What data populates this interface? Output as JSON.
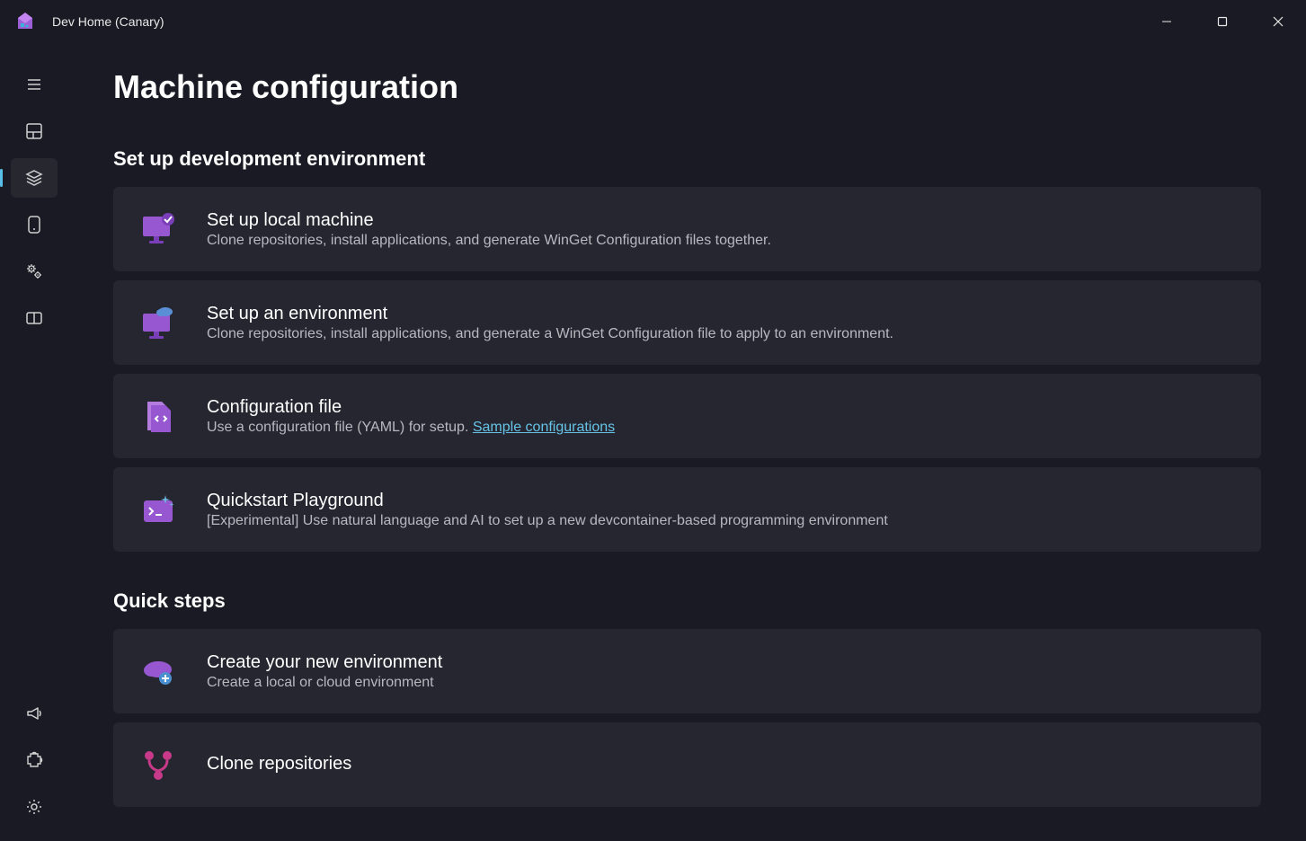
{
  "titlebar": {
    "app_title": "Dev Home (Canary)"
  },
  "page": {
    "title": "Machine configuration"
  },
  "sections": {
    "setup": {
      "header": "Set up development environment",
      "cards": [
        {
          "title": "Set up local machine",
          "desc": "Clone repositories, install applications, and generate WinGet Configuration files together."
        },
        {
          "title": "Set up an environment",
          "desc": "Clone repositories, install applications, and generate a WinGet Configuration file to apply to an environment."
        },
        {
          "title": "Configuration file",
          "desc_prefix": "Use a configuration file (YAML) for setup. ",
          "link": "Sample configurations"
        },
        {
          "title": "Quickstart Playground",
          "desc": "[Experimental] Use natural language and AI to set up a new devcontainer-based programming environment"
        }
      ]
    },
    "quick": {
      "header": "Quick steps",
      "cards": [
        {
          "title": "Create your new environment",
          "desc": "Create a local or cloud environment"
        },
        {
          "title": "Clone repositories",
          "desc": ""
        }
      ]
    }
  }
}
